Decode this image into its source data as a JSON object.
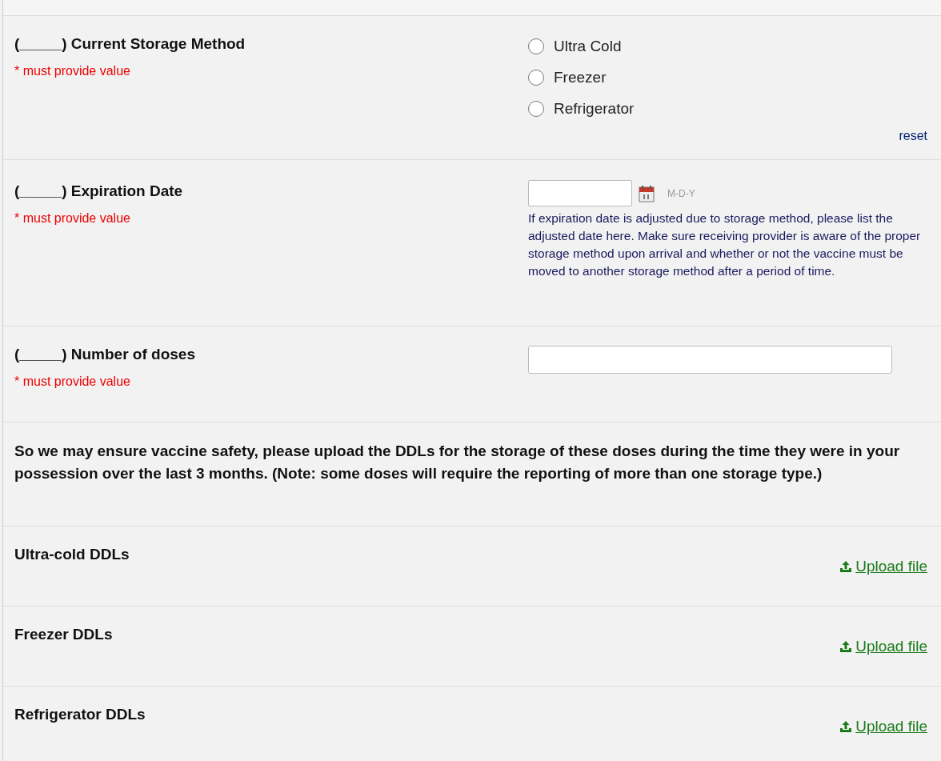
{
  "fields": [
    {
      "kind": "radio",
      "label": "(_____) Current Storage Method",
      "required_note": "* must provide value",
      "options": [
        {
          "label": "Ultra Cold",
          "selected": false
        },
        {
          "label": "Freezer",
          "selected": false
        },
        {
          "label": "Refrigerator",
          "selected": false
        }
      ],
      "reset": "reset"
    },
    {
      "kind": "date",
      "label": "(_____) Expiration Date",
      "required_note": "* must provide value",
      "format": "M-D-Y",
      "help": "If expiration date is adjusted due to storage method, please list the adjusted date here. Make sure receiving provider is aware of the proper storage method upon arrival and whether or not the vaccine must be moved to another storage method after a period of time."
    },
    {
      "kind": "text",
      "label": "(_____) Number of doses",
      "required_note": "* must provide value"
    },
    {
      "kind": "note",
      "label": "So we may ensure vaccine safety, please upload the DDLs for the storage of these doses during the time they were in your possession over the last 3 months. (Note: some doses will require the reporting of more than one storage type.)"
    },
    {
      "kind": "upload",
      "label": "Ultra-cold DDLs",
      "link": "Upload file"
    },
    {
      "kind": "upload",
      "label": "Freezer DDLs",
      "link": "Upload file"
    },
    {
      "kind": "upload",
      "label": "Refrigerator DDLs",
      "link": "Upload file"
    }
  ]
}
